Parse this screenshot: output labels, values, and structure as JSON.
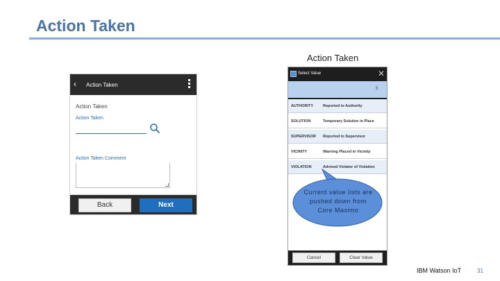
{
  "slide": {
    "title": "Action Taken",
    "page_number": "31",
    "brand": "IBM Watson IoT",
    "accent_color": "#4a74a8",
    "rule_color": "#7fb3e0"
  },
  "left_phone": {
    "header_back_icon": "chevron-left-icon",
    "header_title": "Action Taken",
    "menu_icon": "kebab-menu-icon",
    "section_title": "Action Taken",
    "field1_label": "Action Taken",
    "field1_value": "",
    "search_icon": "search-icon",
    "field2_label": "Action Taken Comment",
    "field2_value": "",
    "back_button": "Back",
    "next_button": "Next",
    "next_color": "#1f6fc0"
  },
  "right_phone": {
    "caption": "Action Taken",
    "header_title": "Select Value",
    "close_icon": "close-icon",
    "count": "5",
    "rows": [
      {
        "code": "AUTHORITY",
        "description": "Reported to Authority"
      },
      {
        "code": "SOLUTION",
        "description": "Temporary Solution in Place"
      },
      {
        "code": "SUPERVISOR",
        "description": "Reported to Supervisor"
      },
      {
        "code": "VICINITY",
        "description": "Warning Placed in Vicinity"
      },
      {
        "code": "VIOLATION",
        "description": "Advised Violator of Violation"
      }
    ],
    "cancel_button": "Cancel",
    "clear_button": "Clear Value",
    "filter_color": "#b8d1ef"
  },
  "callout": {
    "text": "Current value lists are pushed down from Core Maximo",
    "fill_color": "#5b8fd9"
  }
}
